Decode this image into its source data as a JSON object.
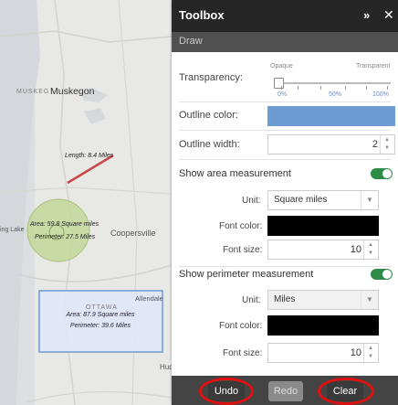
{
  "map": {
    "labels": {
      "muskegon_small": "MUSKEG",
      "muskegon": "Muskegon",
      "coopersville": "Coopersville",
      "allendale": "Allendale",
      "ottawa": "OTTAWA",
      "spring_lake": "ing Lake",
      "hudsonville": "Hud"
    },
    "measurements": {
      "line_length": "Length: 8.4 Miles",
      "circle_area": "Area: 59.8 Square miles",
      "circle_perimeter": "Perimeter: 27.5 Miles",
      "rect_area": "Area: 87.9 Square miles",
      "rect_perimeter": "Perimeter: 39.6 Miles"
    }
  },
  "toolbox": {
    "title": "Toolbox",
    "section": "Draw",
    "transparency": {
      "label": "Transparency:",
      "opaque": "Opaque",
      "transparent": "Transparent",
      "ticks": [
        "0%",
        "50%",
        "100%"
      ],
      "value_percent": 0
    },
    "outline_color": {
      "label": "Outline color:",
      "color": "#6d9cd3"
    },
    "outline_width": {
      "label": "Outline width:",
      "value": "2"
    },
    "area": {
      "label": "Show area measurement",
      "enabled": true,
      "unit_label": "Unit:",
      "unit_value": "Square miles",
      "font_color_label": "Font color:",
      "font_color": "#000000",
      "font_size_label": "Font size:",
      "font_size": "10"
    },
    "perimeter": {
      "label": "Show perimeter measurement",
      "enabled": true,
      "unit_label": "Unit:",
      "unit_value": "Miles",
      "font_color_label": "Font color:",
      "font_color": "#000000",
      "font_size_label": "Font size:",
      "font_size": "10"
    },
    "buttons": {
      "undo": "Undo",
      "redo": "Redo",
      "clear": "Clear"
    },
    "accent": "#2f8c48",
    "highlight": "#e01010"
  }
}
